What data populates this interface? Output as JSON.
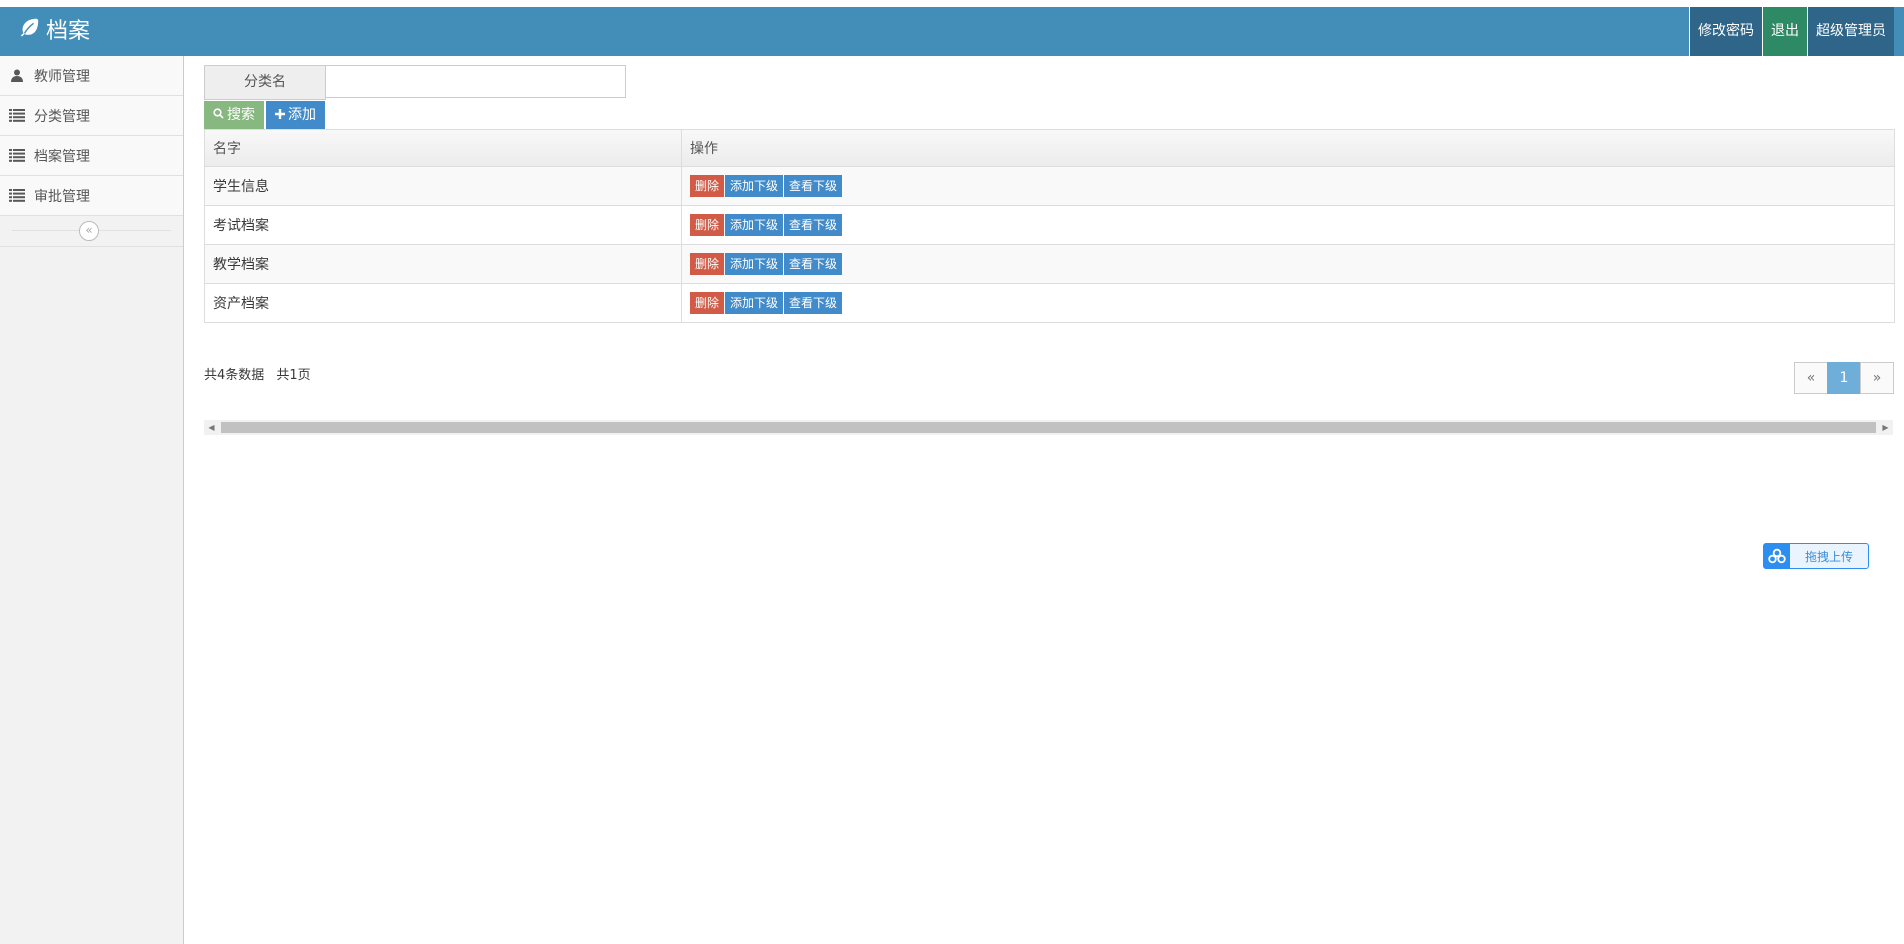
{
  "header": {
    "brand": "档案",
    "actions": [
      {
        "label": "修改密码"
      },
      {
        "label": "退出"
      },
      {
        "label": "超级管理员"
      }
    ]
  },
  "sidebar": {
    "items": [
      {
        "label": "教师管理",
        "icon": "user-icon"
      },
      {
        "label": "分类管理",
        "icon": "list-icon"
      },
      {
        "label": "档案管理",
        "icon": "list-icon"
      },
      {
        "label": "审批管理",
        "icon": "list-icon"
      }
    ],
    "collapse_glyph": "«"
  },
  "search": {
    "label": "分类名",
    "value": "",
    "search_button": "搜索",
    "add_button": "添加"
  },
  "table": {
    "headers": [
      "名字",
      "操作"
    ],
    "rows": [
      {
        "name": "学生信息"
      },
      {
        "name": "考试档案"
      },
      {
        "name": "教学档案"
      },
      {
        "name": "资产档案"
      }
    ],
    "actions": {
      "delete": "删除",
      "add_child": "添加下级",
      "view_child": "查看下级"
    }
  },
  "pagination": {
    "summary": "共4条数据 共1页",
    "prev": "«",
    "current": "1",
    "next": "»"
  },
  "upload_widget": {
    "label": "拖拽上传"
  },
  "colors": {
    "header_bg": "#438eb9",
    "search_btn": "#87b87f",
    "primary": "#428bca",
    "danger": "#d15b47",
    "logout_btn": "#2e8965"
  }
}
